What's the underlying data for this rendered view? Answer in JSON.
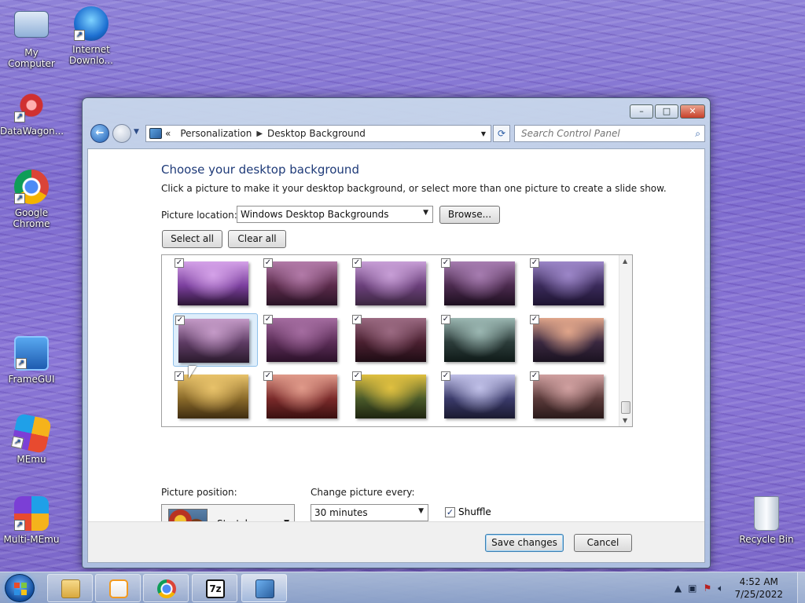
{
  "desktop": {
    "icons": [
      {
        "label": "My Computer"
      },
      {
        "label": "Internet Downlo..."
      },
      {
        "label": "DataWagon..."
      },
      {
        "label": "Google Chrome"
      },
      {
        "label": "FrameGUI"
      },
      {
        "label": "MEmu"
      },
      {
        "label": "Multi-MEmu"
      },
      {
        "label": "Recycle Bin"
      }
    ]
  },
  "window": {
    "controls": {
      "minimize": "–",
      "maximize": "□",
      "close": "✕"
    },
    "address": {
      "prefix": "«",
      "crumbs": [
        "Personalization",
        "Desktop Background"
      ],
      "separator": "▶"
    },
    "search": {
      "placeholder": "Search Control Panel"
    },
    "title": "Choose your desktop background",
    "subtitle": "Click a picture to make it your desktop background, or select more than one picture to create a slide show.",
    "picture_location": {
      "label": "Picture location:",
      "value": "Windows Desktop Backgrounds",
      "browse": "Browse..."
    },
    "select_all": "Select all",
    "clear_all": "Clear all",
    "thumbnails": [
      {
        "checked": true,
        "colors": [
          "#7b3f9e",
          "#d4a1e8",
          "#2b1533"
        ]
      },
      {
        "checked": true,
        "colors": [
          "#5a2a4a",
          "#b27aa8",
          "#2a1426"
        ]
      },
      {
        "checked": true,
        "colors": [
          "#6a3f7a",
          "#c79ed6",
          "#3c2740"
        ]
      },
      {
        "checked": true,
        "colors": [
          "#4b2a4e",
          "#a67cb0",
          "#1d0f1f"
        ]
      },
      {
        "checked": true,
        "colors": [
          "#3a2a5a",
          "#9c86c8",
          "#1d1430"
        ]
      },
      {
        "checked": true,
        "colors": [
          "#5d3b63",
          "#c49ac7",
          "#2a1a2c"
        ],
        "selected": true
      },
      {
        "checked": true,
        "colors": [
          "#5b2d57",
          "#a46ca0",
          "#2b1129"
        ]
      },
      {
        "checked": true,
        "colors": [
          "#4a2030",
          "#9b6a82",
          "#1e0c14"
        ]
      },
      {
        "checked": true,
        "colors": [
          "#2c3c3a",
          "#9bb7b2",
          "#0f1a18"
        ]
      },
      {
        "checked": true,
        "colors": [
          "#3a2840",
          "#e0a58a",
          "#1a1220"
        ]
      },
      {
        "checked": true,
        "colors": [
          "#8a6a2a",
          "#e8c26a",
          "#3e2c10"
        ]
      },
      {
        "checked": true,
        "colors": [
          "#7a2a2a",
          "#e09a8a",
          "#3a1010"
        ]
      },
      {
        "checked": true,
        "colors": [
          "#4a5a2a",
          "#e0c040",
          "#1e2410"
        ]
      },
      {
        "checked": true,
        "colors": [
          "#3a3a6a",
          "#c0c0e8",
          "#1a1a30"
        ]
      },
      {
        "checked": true,
        "colors": [
          "#5a3a3a",
          "#d0a0a0",
          "#2a1a1a"
        ]
      }
    ],
    "picture_position": {
      "label": "Picture position:",
      "value": "Stretch"
    },
    "change_every": {
      "label": "Change picture every:",
      "value": "30 minutes"
    },
    "shuffle": {
      "label": "Shuffle",
      "checked": true
    },
    "save": "Save changes",
    "cancel": "Cancel"
  },
  "taskbar": {
    "buttons": [
      "explorer",
      "media-player",
      "chrome",
      "7zip",
      "control-panel"
    ],
    "clock": {
      "time": "4:52 AM",
      "date": "7/25/2022"
    }
  }
}
